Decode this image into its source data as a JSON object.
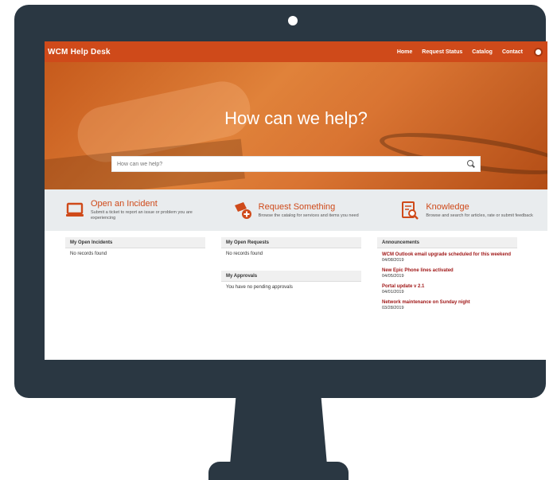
{
  "brand": "WCM Help Desk",
  "nav": {
    "links": [
      "Home",
      "Request Status",
      "Catalog",
      "Contact"
    ]
  },
  "hero": {
    "title": "How can we help?",
    "search_placeholder": "How can we help?"
  },
  "actions": [
    {
      "title": "Open an Incident",
      "desc": "Submit a ticket to report an issue or problem you are experiencing"
    },
    {
      "title": "Request Something",
      "desc": "Browse the catalog for services and items you need"
    },
    {
      "title": "Knowledge",
      "desc": "Browse and search for articles, rate or submit feedback"
    }
  ],
  "widgets": {
    "my_open_incidents": {
      "header": "My Open Incidents",
      "item": "No records found"
    },
    "my_open_requests": {
      "header": "My Open Requests",
      "item": "No records found"
    },
    "my_approvals": {
      "header": "My Approvals",
      "item": "You have no pending approvals"
    },
    "announcements": {
      "header": "Announcements",
      "items": [
        {
          "title": "WCM Outlook email upgrade scheduled for this weekend",
          "date": "04/08/2019"
        },
        {
          "title": "New Epic Phone lines activated",
          "date": "04/05/2019"
        },
        {
          "title": "Portal update v 2.1",
          "date": "04/01/2019"
        },
        {
          "title": "Network maintenance on Sunday night",
          "date": "03/28/2019"
        }
      ]
    }
  },
  "colors": {
    "accent": "#cf4a1a",
    "bezel": "#2a3742",
    "announcement": "#a01818"
  },
  "icons": {
    "incident": "laptop-icon",
    "request": "cart-add-icon",
    "knowledge": "document-search-icon"
  }
}
